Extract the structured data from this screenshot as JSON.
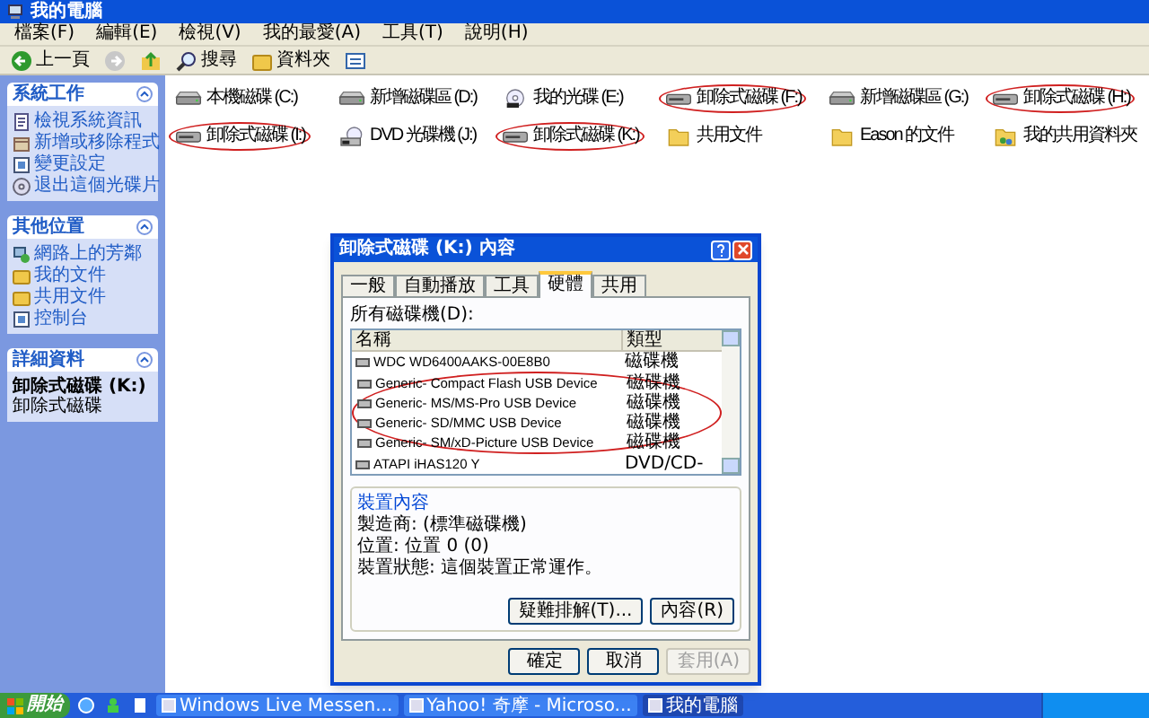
{
  "window": {
    "title": "我的電腦"
  },
  "menu": [
    "檔案(F)",
    "編輯(E)",
    "檢視(V)",
    "我的最愛(A)",
    "工具(T)",
    "說明(H)"
  ],
  "toolbar": [
    {
      "kind": "back",
      "label": "上一頁"
    },
    {
      "kind": "forward"
    },
    {
      "kind": "up"
    },
    {
      "kind": "search",
      "label": "搜尋"
    },
    {
      "kind": "folders",
      "label": "資料夾"
    },
    {
      "kind": "views"
    }
  ],
  "sidebar": {
    "panels": [
      {
        "title": "系統工作",
        "items": [
          {
            "kind": "info",
            "label": "檢視系統資訊"
          },
          {
            "kind": "programs",
            "label": "新增或移除程式"
          },
          {
            "kind": "settings",
            "label": "變更設定"
          },
          {
            "kind": "eject",
            "label": "退出這個光碟片"
          }
        ]
      },
      {
        "title": "其他位置",
        "items": [
          {
            "kind": "network",
            "label": "網路上的芳鄰"
          },
          {
            "kind": "folder",
            "label": "我的文件"
          },
          {
            "kind": "folder",
            "label": "共用文件"
          },
          {
            "kind": "settings",
            "label": "控制台"
          }
        ]
      }
    ],
    "details": {
      "title": "詳細資料",
      "name": "卸除式磁碟 (K:)",
      "type": "卸除式磁碟"
    }
  },
  "drives": [
    {
      "kind": "hdd",
      "label": "本機磁碟 (C:)",
      "circled": false
    },
    {
      "kind": "hdd",
      "label": "新增磁碟區 (D:)",
      "circled": false
    },
    {
      "kind": "cd",
      "label": "我的光碟 (E:)",
      "circled": false
    },
    {
      "kind": "removable",
      "label": "卸除式磁碟 (F:)",
      "circled": true
    },
    {
      "kind": "hdd",
      "label": "新增磁碟區 (G:)",
      "circled": false
    },
    {
      "kind": "removable",
      "label": "卸除式磁碟 (H:)",
      "circled": true
    },
    {
      "kind": "removable",
      "label": "卸除式磁碟 (I:)",
      "circled": true
    },
    {
      "kind": "dvd",
      "label": "DVD 光碟機 (J:)",
      "circled": false
    },
    {
      "kind": "removable",
      "label": "卸除式磁碟 (K:)",
      "circled": true
    },
    {
      "kind": "folder",
      "label": "共用文件",
      "circled": false
    },
    {
      "kind": "folder",
      "label": "Eason 的文件",
      "circled": false
    },
    {
      "kind": "shared",
      "label": "我的共用資料夾",
      "circled": false
    }
  ],
  "dialog": {
    "title": "卸除式磁碟 (K:) 內容",
    "tabs": [
      {
        "label": "一般",
        "selected": false
      },
      {
        "label": "自動播放",
        "selected": false
      },
      {
        "label": "工具",
        "selected": false
      },
      {
        "label": "硬體",
        "selected": true
      },
      {
        "label": "共用",
        "selected": false
      }
    ],
    "list_label": "所有磁碟機(D):",
    "columns": [
      "名稱",
      "類型"
    ],
    "rows": [
      {
        "name": "WDC WD6400AAKS-00E8B0",
        "type": "磁碟機",
        "circled": false
      },
      {
        "name": "Generic- Compact Flash USB Device",
        "type": "磁碟機",
        "circled": true
      },
      {
        "name": "Generic- MS/MS-Pro USB Device",
        "type": "磁碟機",
        "circled": true
      },
      {
        "name": "Generic- SD/MMC USB Device",
        "type": "磁碟機",
        "circled": true
      },
      {
        "name": "Generic- SM/xD-Picture USB Device",
        "type": "磁碟機",
        "circled": true
      },
      {
        "name": "ATAPI iHAS120 Y",
        "type": "DVD/CD-",
        "circled": false
      }
    ],
    "group_title": "裝置內容",
    "properties": [
      "製造商: (標準磁碟機)",
      "位置: 位置 0 (0)",
      "裝置狀態: 這個裝置正常運作。"
    ],
    "group_buttons": [
      {
        "label": "疑難排解(T)...",
        "disabled": false
      },
      {
        "label": "內容(R)",
        "disabled": false
      }
    ],
    "buttons": [
      {
        "label": "確定",
        "disabled": false
      },
      {
        "label": "取消",
        "disabled": false
      },
      {
        "label": "套用(A)",
        "disabled": true
      }
    ]
  },
  "taskbar": {
    "start": "開始",
    "tasks": [
      {
        "label": "Windows Live Messen...",
        "selected": false
      },
      {
        "label": "Yahoo! 奇摩 - Microso...",
        "selected": false
      },
      {
        "label": "我的電腦",
        "selected": true
      }
    ]
  }
}
